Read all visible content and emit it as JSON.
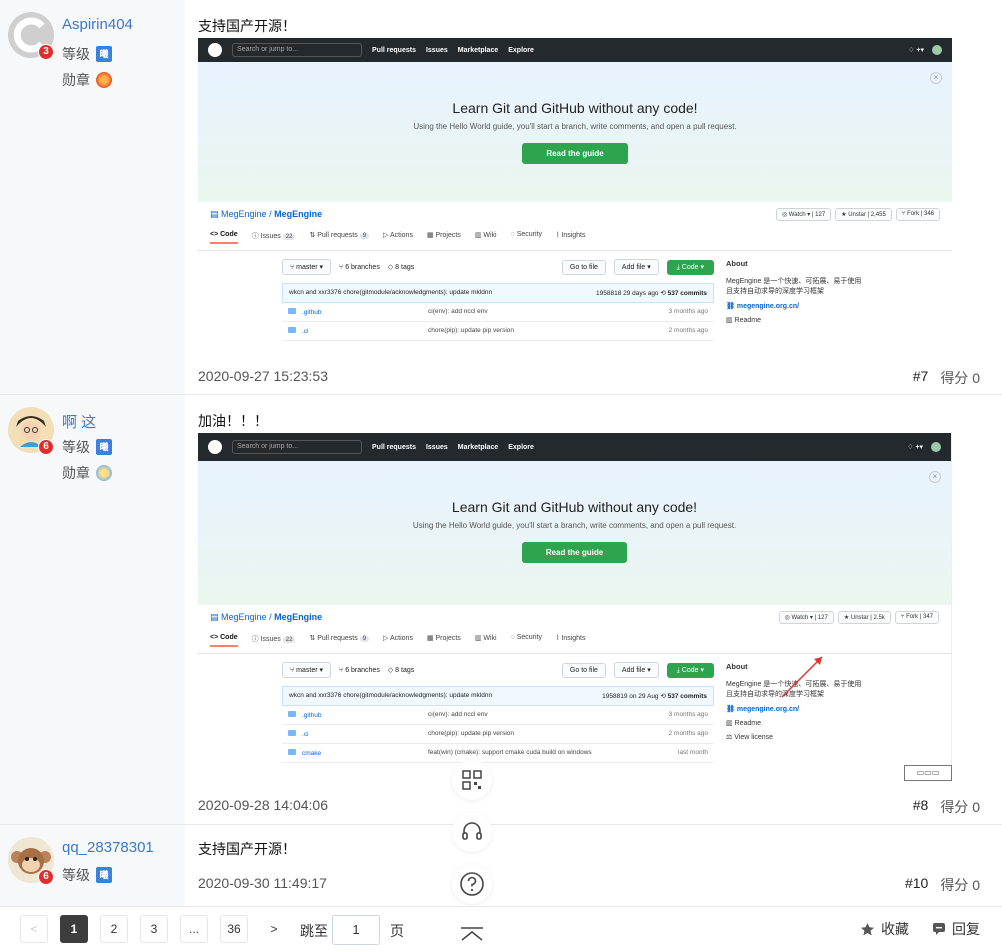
{
  "posts": [
    {
      "username": "Aspirin404",
      "years": "3",
      "level_label": "等级",
      "level_badge": "曦",
      "medal_label": "勋章",
      "text": "支持国产开源！",
      "date": "2020-09-27 15:23:53",
      "floor": "#7",
      "score": "得分 0"
    },
    {
      "username": "啊 这",
      "years": "6",
      "level_label": "等级",
      "level_badge": "曦",
      "medal_label": "勋章",
      "text": "加油！！！",
      "date": "2020-09-28 14:04:06",
      "floor": "#8",
      "score": "得分 0"
    },
    {
      "username": "qq_28378301",
      "years": "6",
      "level_label": "等级",
      "level_badge": "曦",
      "text": "支持国产开源！",
      "date": "2020-09-30 11:49:17",
      "floor": "#10",
      "score": "得分 0"
    }
  ],
  "github": {
    "search_placeholder": "Search or jump to...",
    "nav": [
      "Pull requests",
      "Issues",
      "Marketplace",
      "Explore"
    ],
    "hero_title": "Learn Git and GitHub without any code!",
    "hero_sub": "Using the Hello World guide, you'll start a branch, write comments, and open a pull request.",
    "hero_btn": "Read the guide",
    "repo_owner": "MegEngine",
    "repo_name": "MegEngine",
    "watch": "Watch",
    "watch_count": "127",
    "unstar": "Unstar",
    "star_count_1": "2,455",
    "star_count_2": "2.5k",
    "fork": "Fork",
    "fork_count_1": "346",
    "fork_count_2": "347",
    "tabs": [
      "<> Code",
      "Issues",
      "Pull requests",
      "Actions",
      "Projects",
      "Wiki",
      "Security",
      "Insights"
    ],
    "issues_count": "22",
    "pr_count": "9",
    "branch": "master",
    "branches": "6 branches",
    "tags": "8 tags",
    "go_to_file": "Go to file",
    "add_file": "Add file",
    "code_btn": "Code",
    "commit_author": "wkcn and xxr3376 chore(gitmodule/acknowledgments): update mkldnn",
    "commit_meta_1": "1958818  29 days ago",
    "commit_meta_2": "1958819  on 29 Aug",
    "commits": "537 commits",
    "files": [
      {
        "name": ".github",
        "msg": "ci(env): add nccl env",
        "date": "3 months ago"
      },
      {
        "name": ".ci",
        "msg": "chore(pip): update pip version",
        "date": "2 months ago"
      },
      {
        "name": "cmake",
        "msg": "feat(win) (cmake): support cmake cuda build on windows",
        "date": "last month"
      }
    ],
    "about_title": "About",
    "about_desc": "MegEngine 是一个快速、可拓展、易于使用且支持自动求导的深度学习框架",
    "about_link": "megengine.org.cn/",
    "readme": "Readme",
    "license": "View license"
  },
  "pagination": {
    "prev": "<",
    "pages": [
      "1",
      "2",
      "3",
      "...",
      "36"
    ],
    "next": ">",
    "jump_label": "跳至",
    "jump_value": "1",
    "page_label": "页"
  },
  "actions": {
    "favorite": "收藏",
    "reply": "回复"
  },
  "colors": {
    "accent": "#3c78c8",
    "github_green": "#2ea44f",
    "badge_red": "#e02d2d"
  }
}
